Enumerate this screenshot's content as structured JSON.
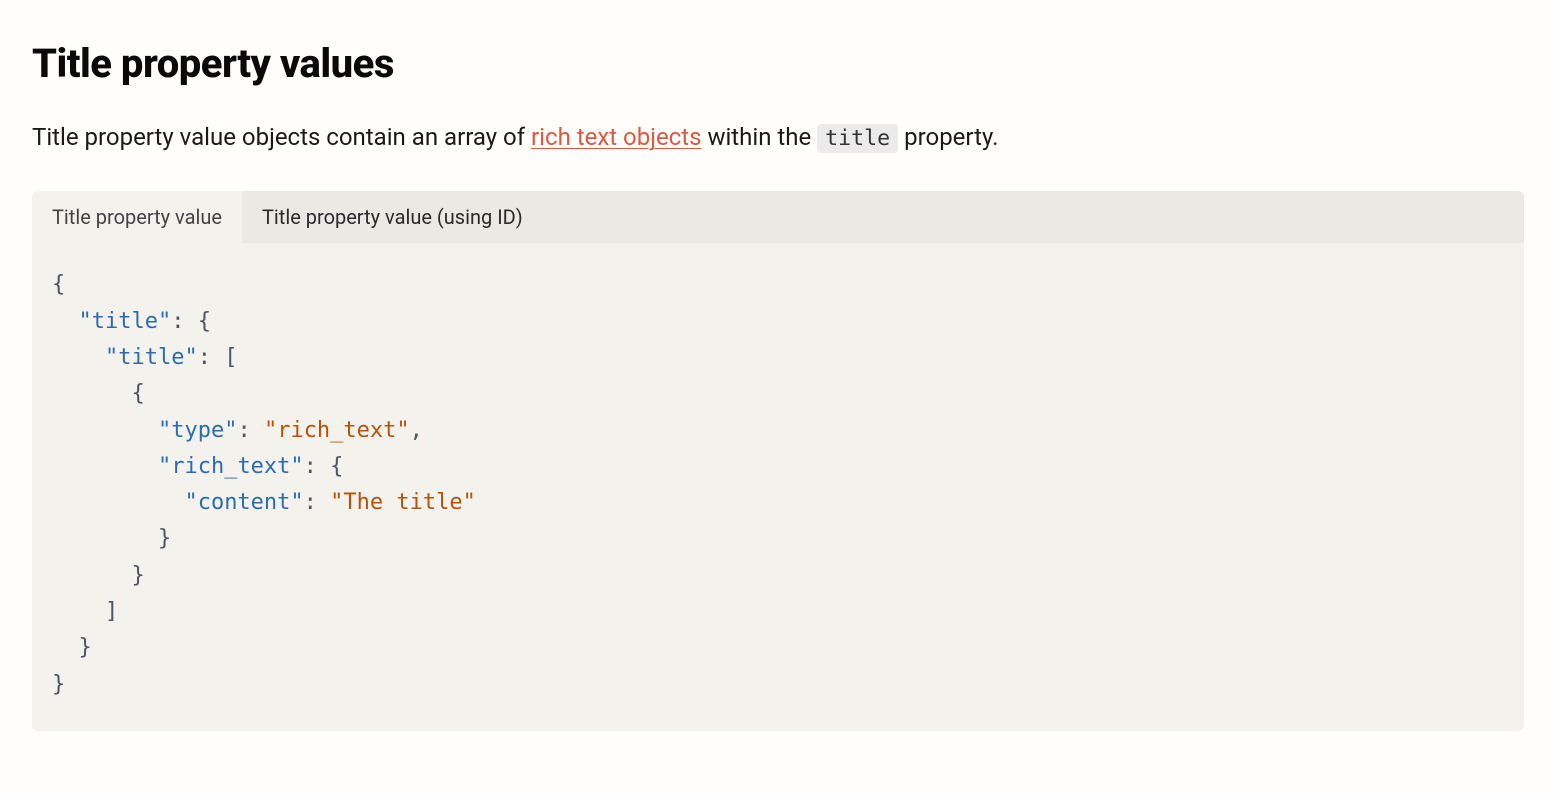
{
  "heading": "Title property values",
  "description": {
    "prefix": "Title property value objects contain an array of ",
    "link_text": "rich text objects",
    "mid": " within the ",
    "code": "title",
    "suffix": " property."
  },
  "tabs": {
    "tab1_label": "Title property value",
    "tab2_label": "Title property value (using ID)"
  },
  "code": {
    "brace_open": "{",
    "brace_close": "}",
    "bracket_open": "[",
    "bracket_close": "]",
    "colon": ":",
    "comma": ",",
    "key_title": "\"title\"",
    "key_type": "\"type\"",
    "key_rich_text": "\"rich_text\"",
    "key_content": "\"content\"",
    "val_rich_text": "\"rich_text\"",
    "val_the_title": "\"The title\""
  }
}
